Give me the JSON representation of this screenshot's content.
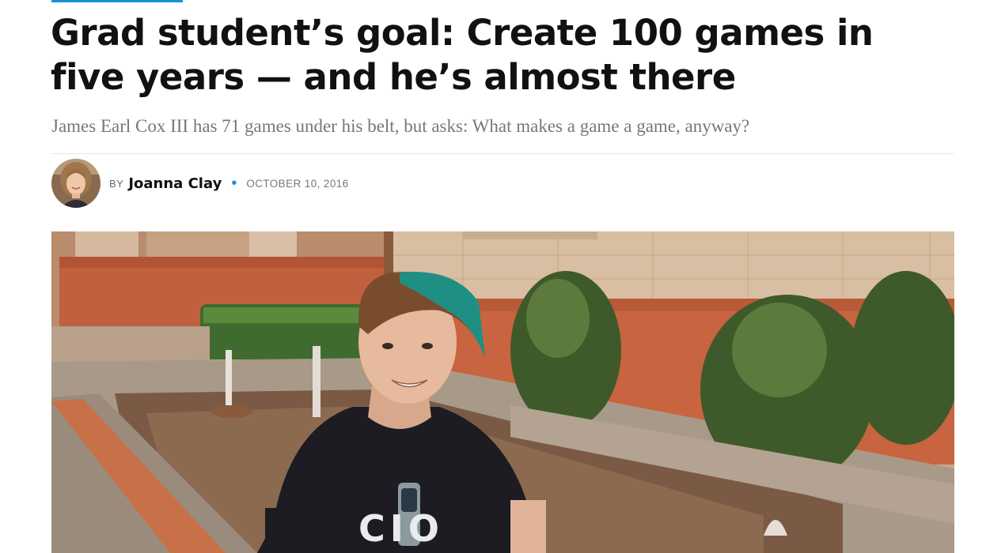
{
  "article": {
    "headline": "Grad student’s goal: Create 100 games in five years — and he’s almost there",
    "subheadline": "James Earl Cox III has 71 games under his belt, but asks: What makes a game a game, anyway?",
    "byline": {
      "prefix": "BY",
      "author": "Joanna Clay",
      "separator": "•",
      "date": "OCTOBER 10, 2016"
    },
    "hero_image": {
      "shirt_text": "CIO"
    }
  },
  "colors": {
    "accent": "#1a8fd8",
    "headline": "#111111",
    "subheadline": "#777777"
  },
  "icons": {
    "author_avatar": "author-avatar"
  }
}
